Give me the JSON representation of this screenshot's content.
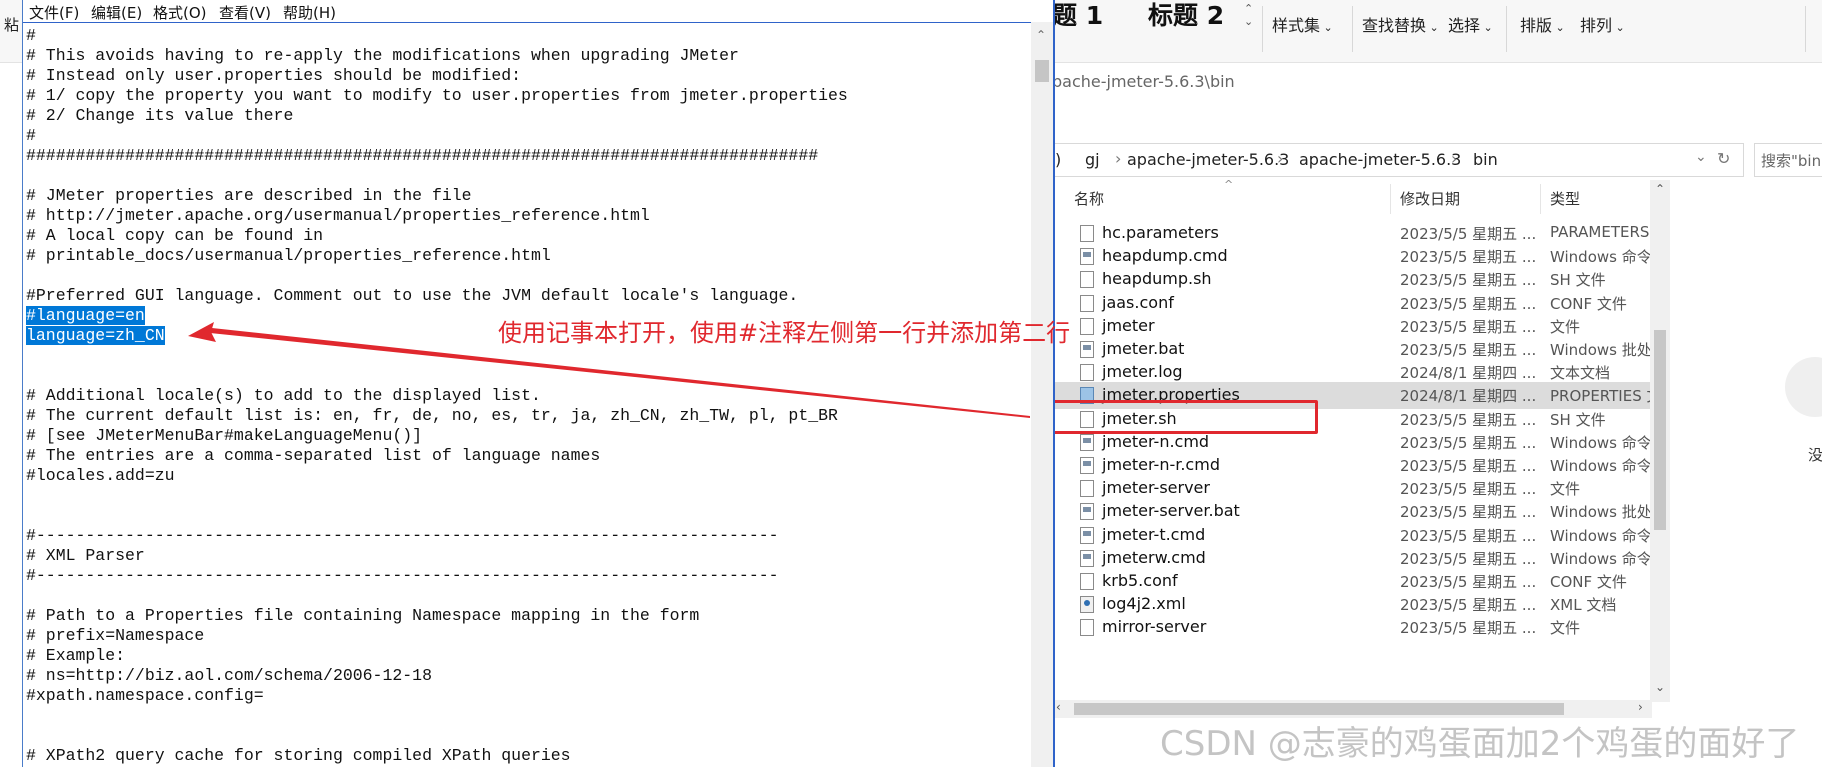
{
  "ribbon": {
    "paste_label": "粘",
    "heading1": "题 1",
    "heading2": "标题 2",
    "styles": "样式集",
    "find_replace": "查找替换",
    "select": "选择",
    "layout": "排版",
    "arrange": "排列"
  },
  "notepad": {
    "menu": [
      "文件(F)",
      "编辑(E)",
      "格式(O)",
      "查看(V)",
      "帮助(H)"
    ],
    "lines": [
      {
        "text": "#",
        "selected": false
      },
      {
        "text": "# This avoids having to re-apply the modifications when upgrading JMeter",
        "selected": false
      },
      {
        "text": "# Instead only user.properties should be modified:",
        "selected": false
      },
      {
        "text": "# 1/ copy the property you want to modify to user.properties from jmeter.properties",
        "selected": false
      },
      {
        "text": "# 2/ Change its value there",
        "selected": false
      },
      {
        "text": "#",
        "selected": false
      },
      {
        "text": "################################################################################",
        "selected": false
      },
      {
        "text": "",
        "selected": false
      },
      {
        "text": "# JMeter properties are described in the file",
        "selected": false
      },
      {
        "text": "# http://jmeter.apache.org/usermanual/properties_reference.html",
        "selected": false
      },
      {
        "text": "# A local copy can be found in",
        "selected": false
      },
      {
        "text": "# printable_docs/usermanual/properties_reference.html",
        "selected": false
      },
      {
        "text": "",
        "selected": false
      },
      {
        "text": "#Preferred GUI language. Comment out to use the JVM default locale's language.",
        "selected": false
      },
      {
        "text": "#language=en",
        "selected": true
      },
      {
        "text": "language=zh_CN",
        "selected": true
      },
      {
        "text": "",
        "selected": false
      },
      {
        "text": "",
        "selected": false
      },
      {
        "text": "# Additional locale(s) to add to the displayed list.",
        "selected": false
      },
      {
        "text": "# The current default list is: en, fr, de, no, es, tr, ja, zh_CN, zh_TW, pl, pt_BR",
        "selected": false
      },
      {
        "text": "# [see JMeterMenuBar#makeLanguageMenu()]",
        "selected": false
      },
      {
        "text": "# The entries are a comma-separated list of language names",
        "selected": false
      },
      {
        "text": "#locales.add=zu",
        "selected": false
      },
      {
        "text": "",
        "selected": false
      },
      {
        "text": "",
        "selected": false
      },
      {
        "text": "#---------------------------------------------------------------------------",
        "selected": false
      },
      {
        "text": "# XML Parser",
        "selected": false
      },
      {
        "text": "#---------------------------------------------------------------------------",
        "selected": false
      },
      {
        "text": "",
        "selected": false
      },
      {
        "text": "# Path to a Properties file containing Namespace mapping in the form",
        "selected": false
      },
      {
        "text": "# prefix=Namespace",
        "selected": false
      },
      {
        "text": "# Example:",
        "selected": false
      },
      {
        "text": "# ns=http://biz.aol.com/schema/2006-12-18",
        "selected": false
      },
      {
        "text": "#xpath.namespace.config=",
        "selected": false
      },
      {
        "text": "",
        "selected": false
      },
      {
        "text": "",
        "selected": false
      },
      {
        "text": "# XPath2 query cache for storing compiled XPath queries",
        "selected": false
      }
    ]
  },
  "annotation": {
    "text": "使用记事本打开，使用#注释左侧第一行并添加第二行",
    "color": "#e0282e"
  },
  "explorer": {
    "path_partial": "pache-jmeter-5.6.3\\bin",
    "breadcrumbs": [
      ")",
      "gj",
      "apache-jmeter-5.6.3",
      "apache-jmeter-5.6.3",
      "bin"
    ],
    "search_placeholder": "搜索\"bin",
    "columns": [
      "名称",
      "修改日期",
      "类型"
    ],
    "selected_file": "jmeter.properties",
    "files": [
      {
        "name": "hc.parameters",
        "date": "2023/5/5 星期五 ...",
        "type": "PARAMETERS",
        "icon": "file-icon"
      },
      {
        "name": "heapdump.cmd",
        "date": "2023/5/5 星期五 ...",
        "type": "Windows 命令",
        "icon": "cmd-icon"
      },
      {
        "name": "heapdump.sh",
        "date": "2023/5/5 星期五 ...",
        "type": "SH 文件",
        "icon": "file-icon"
      },
      {
        "name": "jaas.conf",
        "date": "2023/5/5 星期五 ...",
        "type": "CONF 文件",
        "icon": "file-icon"
      },
      {
        "name": "jmeter",
        "date": "2023/5/5 星期五 ...",
        "type": "文件",
        "icon": "file-icon"
      },
      {
        "name": "jmeter.bat",
        "date": "2023/5/5 星期五 ...",
        "type": "Windows 批处",
        "icon": "cmd-icon"
      },
      {
        "name": "jmeter.log",
        "date": "2024/8/1 星期四 ...",
        "type": "文本文档",
        "icon": "file-icon"
      },
      {
        "name": "jmeter.properties",
        "date": "2024/8/1 星期四 ...",
        "type": "PROPERTIES 文",
        "icon": "properties-icon"
      },
      {
        "name": "jmeter.sh",
        "date": "2023/5/5 星期五 ...",
        "type": "SH 文件",
        "icon": "file-icon"
      },
      {
        "name": "jmeter-n.cmd",
        "date": "2023/5/5 星期五 ...",
        "type": "Windows 命令",
        "icon": "cmd-icon"
      },
      {
        "name": "jmeter-n-r.cmd",
        "date": "2023/5/5 星期五 ...",
        "type": "Windows 命令",
        "icon": "cmd-icon"
      },
      {
        "name": "jmeter-server",
        "date": "2023/5/5 星期五 ...",
        "type": "文件",
        "icon": "file-icon"
      },
      {
        "name": "jmeter-server.bat",
        "date": "2023/5/5 星期五 ...",
        "type": "Windows 批处",
        "icon": "cmd-icon"
      },
      {
        "name": "jmeter-t.cmd",
        "date": "2023/5/5 星期五 ...",
        "type": "Windows 命令",
        "icon": "cmd-icon"
      },
      {
        "name": "jmeterw.cmd",
        "date": "2023/5/5 星期五 ...",
        "type": "Windows 命令",
        "icon": "cmd-icon"
      },
      {
        "name": "krb5.conf",
        "date": "2023/5/5 星期五 ...",
        "type": "CONF 文件",
        "icon": "file-icon"
      },
      {
        "name": "log4j2.xml",
        "date": "2023/5/5 星期五 ...",
        "type": "XML 文档",
        "icon": "xml-icon"
      },
      {
        "name": "mirror-server",
        "date": "2023/5/5 星期五 ...",
        "type": "文件",
        "icon": "file-icon"
      }
    ],
    "right_pane_char": "没"
  },
  "watermark": "CSDN @志豪的鸡蛋面加2个鸡蛋的面好了"
}
